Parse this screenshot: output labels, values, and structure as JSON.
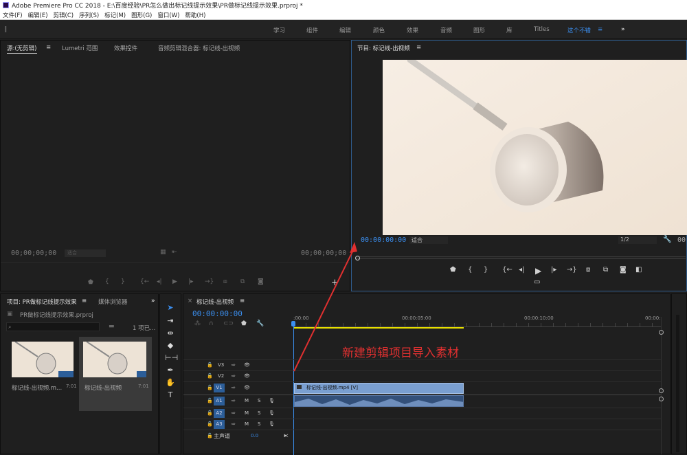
{
  "title": "Adobe Premiere Pro CC 2018 - E:\\百度经验\\PR怎么做出标记线提示效果\\PR做标记线提示效果.prproj *",
  "menu": [
    "文件(F)",
    "编辑(E)",
    "剪辑(C)",
    "序列(S)",
    "标记(M)",
    "图形(G)",
    "窗口(W)",
    "帮助(H)"
  ],
  "workspaces": [
    "学习",
    "组件",
    "编辑",
    "颜色",
    "效果",
    "音频",
    "图形",
    "库",
    "Titles",
    "这个不错"
  ],
  "workspaces_more": "»",
  "source_panel": {
    "tabs": [
      "源:(无剪辑)",
      "Lumetri 范围",
      "效果控件",
      "音频剪辑混合器: 标记线-出视频"
    ],
    "timecode_left": "00;00;00;00",
    "timecode_right": "00;00;00;00",
    "zoom_value": "适合"
  },
  "program_panel": {
    "tab": "节目: 标记线-出视频",
    "timecode": "00:00:00:00",
    "fit": "适合",
    "resolution": "1/2",
    "timecode_right": "00:"
  },
  "project_panel": {
    "tabs": [
      "项目: PR做标记线提示效果",
      "媒体浏览器"
    ],
    "filename": "PR做标记线提示效果.prproj",
    "item_count": "1 项已...",
    "items": [
      {
        "name": "标记线-出视频.m...",
        "duration": "7:01"
      },
      {
        "name": "标记线-出视频",
        "duration": "7:01"
      }
    ]
  },
  "timeline": {
    "tab": "标记线-出视频",
    "timecode": "00:00:00:00",
    "ruler": [
      ":00:00",
      "00:00:05:00",
      "00:00:10:00",
      "00:00:"
    ],
    "video_tracks": [
      "V3",
      "V2",
      "V1"
    ],
    "audio_tracks": [
      "A1",
      "A2",
      "A3"
    ],
    "master_label": "主声道",
    "master_value": "0.0",
    "clip_label": "标记线-出视频.mp4 [V]",
    "mute": "M",
    "solo": "S"
  },
  "annotation": "新建剪辑项目导入素材",
  "colors": {
    "accent": "#3b8ff0",
    "annotation": "#e03030",
    "clip_video": "#7a9fd0",
    "clip_audio": "#33507a"
  }
}
